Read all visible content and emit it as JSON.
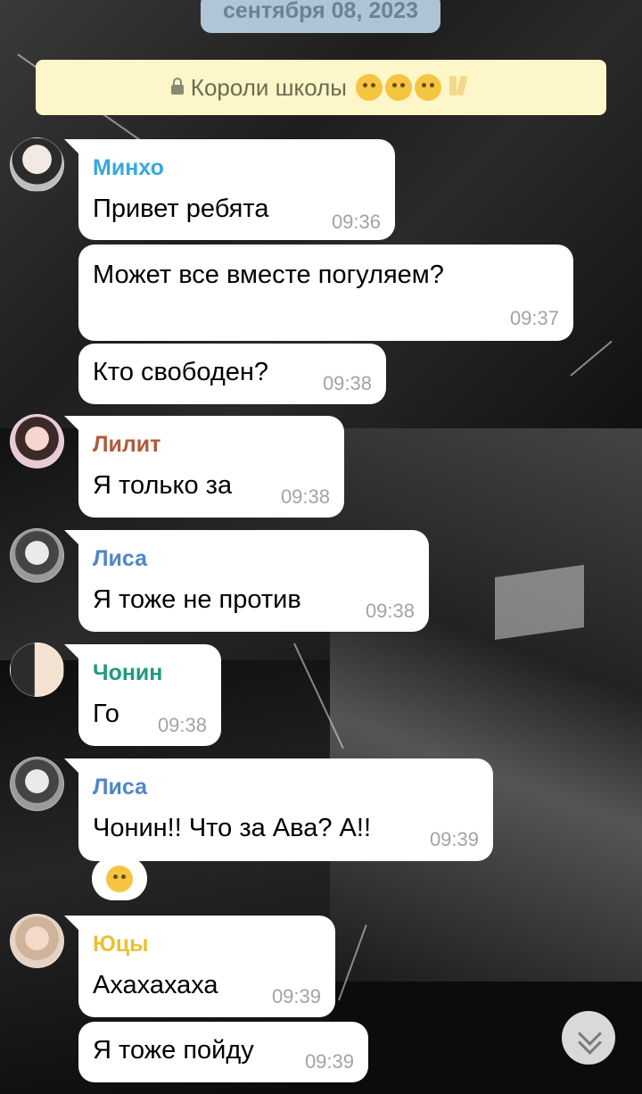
{
  "date_divider": "сентября 08, 2023",
  "pinned": {
    "text": "Короли школы",
    "emojis": [
      "grinning-face-icon",
      "joy-face-icon",
      "smirk-face-icon",
      "clinking-glasses-icon"
    ]
  },
  "colors": {
    "minho": "#36a8e0",
    "lilit": "#b05a3a",
    "lisa": "#4f86c8",
    "chonin": "#1f9a7a",
    "yutsy": "#e8c22e"
  },
  "messages": [
    {
      "sender": "Минхо",
      "text": "Привет ребята",
      "time": "09:36"
    },
    {
      "text": "Может все вместе погуляем?",
      "time": "09:37"
    },
    {
      "text": "Кто свободен?",
      "time": "09:38"
    },
    {
      "sender": "Лилит",
      "text": "Я только за",
      "time": "09:38"
    },
    {
      "sender": "Лиса",
      "text": "Я тоже не против",
      "time": "09:38"
    },
    {
      "sender": "Чонин",
      "text": "Го",
      "time": "09:38"
    },
    {
      "sender": "Лиса",
      "text": "Чонин!! Что за Ава? А!!",
      "time": "09:39",
      "reaction": "joy-face-icon"
    },
    {
      "sender": "Юцы",
      "text": "Ахахахаха",
      "time": "09:39"
    },
    {
      "text": "Я тоже пойду",
      "time": "09:39"
    }
  ]
}
